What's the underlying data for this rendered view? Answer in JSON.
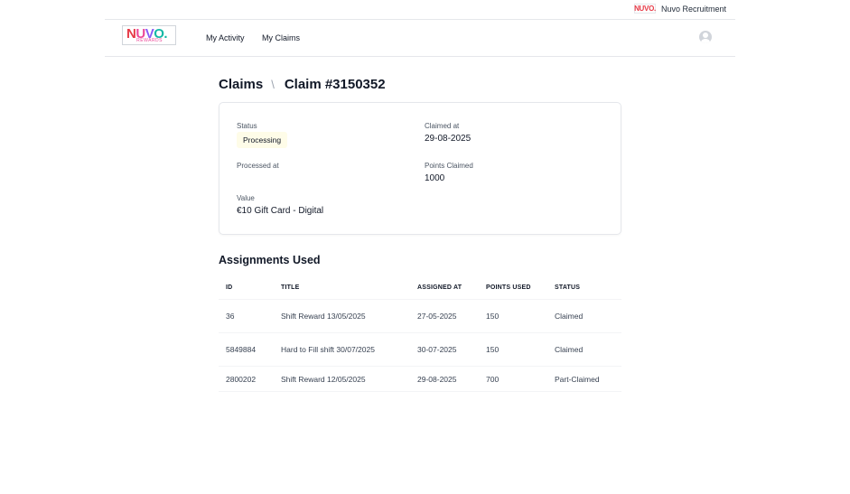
{
  "top_strip": {
    "mini_logo": "NUVO.",
    "org_name": "Nuvo Recruitment"
  },
  "header": {
    "logo": {
      "n": "N",
      "u": "U",
      "v": "V",
      "o": "O.",
      "sub": "REWARDS"
    },
    "nav": {
      "my_activity": "My Activity",
      "my_claims": "My Claims"
    },
    "avatar_icon": "user-avatar-icon"
  },
  "breadcrumb": {
    "parent": "Claims",
    "separator": "\\",
    "current": "Claim #3150352"
  },
  "claim": {
    "status_label": "Status",
    "status_value": "Processing",
    "claimed_at_label": "Claimed at",
    "claimed_at_value": "29-08-2025",
    "processed_at_label": "Processed at",
    "processed_at_value": "",
    "points_claimed_label": "Points Claimed",
    "points_claimed_value": "1000",
    "value_label": "Value",
    "value_value": "€10 Gift Card - Digital"
  },
  "assignments": {
    "title": "Assignments Used",
    "columns": [
      "ID",
      "TITLE",
      "ASSIGNED AT",
      "POINTS USED",
      "STATUS"
    ],
    "rows": [
      [
        "36",
        "Shift Reward 13/05/2025",
        "27-05-2025",
        "150",
        "Claimed"
      ],
      [
        "5849884",
        "Hard to Fill shift 30/07/2025",
        "30-07-2025",
        "150",
        "Claimed"
      ],
      [
        "2800202",
        "Shift Reward 12/05/2025",
        "29-08-2025",
        "700",
        "Part-Claimed"
      ]
    ]
  },
  "colors": {
    "status_badge_bg": "#fefce8",
    "divider": "#e5e7eb",
    "logo_red": "#e63946",
    "logo_pink": "#ec4899",
    "logo_purple": "#8b5cf6",
    "logo_teal": "#14b8a6"
  }
}
